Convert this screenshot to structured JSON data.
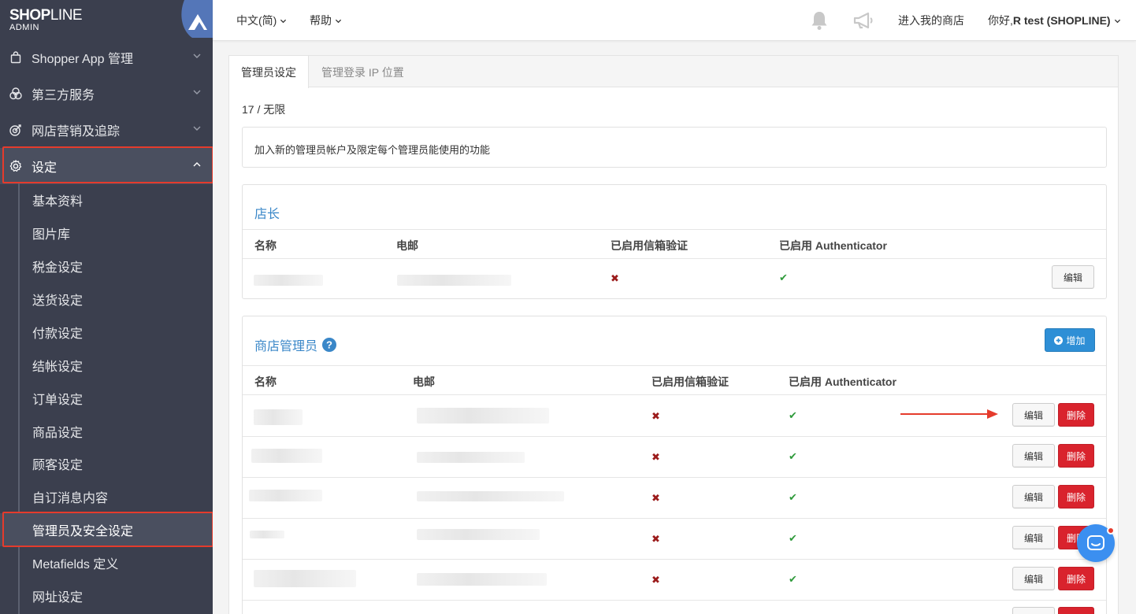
{
  "brand": {
    "name_bold": "SHOP",
    "name_rest": "LINE",
    "sub": "ADMIN"
  },
  "sidebar": {
    "items": [
      {
        "label": "Shopper App 管理",
        "icon": "bag-icon"
      },
      {
        "label": "第三方服务",
        "icon": "circles-icon"
      },
      {
        "label": "网店营销及追踪",
        "icon": "target-icon"
      },
      {
        "label": "设定",
        "icon": "gear-icon"
      }
    ],
    "submenu": [
      "基本资料",
      "图片库",
      "税金设定",
      "送货设定",
      "付款设定",
      "结帐设定",
      "订单设定",
      "商品设定",
      "顾客设定",
      "自订消息内容",
      "管理员及安全设定",
      "Metafields 定义",
      "网址设定"
    ]
  },
  "topbar": {
    "language": "中文(简)",
    "help": "帮助",
    "enter_store": "进入我的商店",
    "greeting": "你好, ",
    "user": "R test (SHOPLINE)"
  },
  "tabs": [
    "管理员设定",
    "管理登录 IP 位置"
  ],
  "count": "17 / 无限",
  "description": "加入新的管理员帐户及限定每个管理员能使用的功能",
  "owner": {
    "title": "店长",
    "headers": [
      "名称",
      "电邮",
      "已启用信箱验证",
      "已启用 Authenticator"
    ],
    "edit_label": "编辑"
  },
  "admins": {
    "title": "商店管理员",
    "add_label": "增加",
    "headers": [
      "名称",
      "电邮",
      "已启用信箱验证",
      "已启用 Authenticator"
    ],
    "edit_label": "编辑",
    "delete_label": "删除",
    "rows": [
      {
        "email_verify": false,
        "authenticator": true
      },
      {
        "email_verify": false,
        "authenticator": true
      },
      {
        "email_verify": false,
        "authenticator": true
      },
      {
        "email_verify": false,
        "authenticator": true
      },
      {
        "email_verify": false,
        "authenticator": true
      }
    ]
  },
  "symbols": {
    "cross": "✖",
    "check": "✔"
  },
  "colors": {
    "sidebar_bg": "#3b3f4e",
    "link_blue": "#3a87c8",
    "danger": "#d9232d",
    "primary": "#2e8fd6",
    "highlight": "#e53b2c"
  }
}
